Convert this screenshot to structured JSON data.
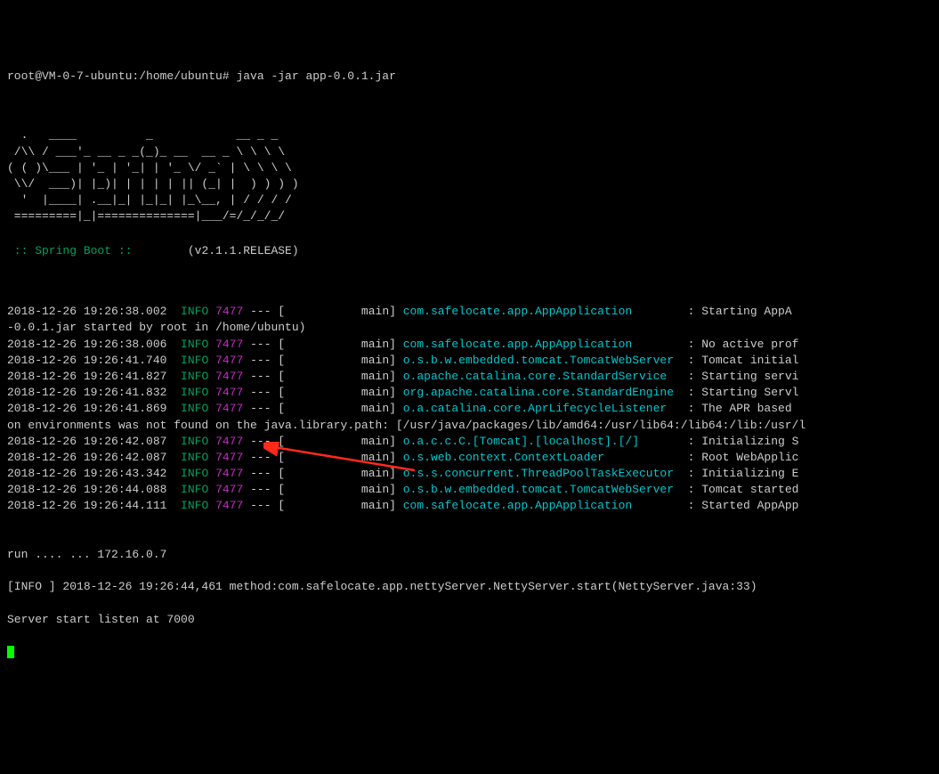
{
  "prompt": "root@VM-0-7-ubuntu:/home/ubuntu# java -jar app-0.0.1.jar",
  "ascii_art": "  .   ____          _            __ _ _\n /\\\\ / ___'_ __ _ _(_)_ __  __ _ \\ \\ \\ \\\n( ( )\\___ | '_ | '_| | '_ \\/ _` | \\ \\ \\ \\\n \\\\/  ___)| |_)| | | | | || (_| |  ) ) ) )\n  '  |____| .__|_| |_|_| |_\\__, | / / / /\n =========|_|==============|___/=/_/_/_/",
  "spring_boot_label": " :: Spring Boot :: ",
  "spring_boot_version": "       (v2.1.1.RELEASE)",
  "log_entries": [
    {
      "ts": "2018-12-26 19:26:38.002",
      "level": "INFO",
      "pid": "7477",
      "thread": "main",
      "logger": "com.safelocate.app.AppApplication      ",
      "msg": "Starting AppA"
    },
    {
      "continuation": "-0.0.1.jar started by root in /home/ubuntu)"
    },
    {
      "ts": "2018-12-26 19:26:38.006",
      "level": "INFO",
      "pid": "7477",
      "thread": "main",
      "logger": "com.safelocate.app.AppApplication      ",
      "msg": "No active prof"
    },
    {
      "ts": "2018-12-26 19:26:41.740",
      "level": "INFO",
      "pid": "7477",
      "thread": "main",
      "logger": "o.s.b.w.embedded.tomcat.TomcatWebServer",
      "msg": "Tomcat initial"
    },
    {
      "ts": "2018-12-26 19:26:41.827",
      "level": "INFO",
      "pid": "7477",
      "thread": "main",
      "logger": "o.apache.catalina.core.StandardService ",
      "msg": "Starting servi"
    },
    {
      "ts": "2018-12-26 19:26:41.832",
      "level": "INFO",
      "pid": "7477",
      "thread": "main",
      "logger": "org.apache.catalina.core.StandardEngine",
      "msg": "Starting Servl"
    },
    {
      "ts": "2018-12-26 19:26:41.869",
      "level": "INFO",
      "pid": "7477",
      "thread": "main",
      "logger": "o.a.catalina.core.AprLifecycleListener ",
      "msg": "The APR based "
    },
    {
      "continuation": "on environments was not found on the java.library.path: [/usr/java/packages/lib/amd64:/usr/lib64:/lib64:/lib:/usr/l"
    },
    {
      "ts": "2018-12-26 19:26:42.087",
      "level": "INFO",
      "pid": "7477",
      "thread": "main",
      "logger": "o.a.c.c.C.[Tomcat].[localhost].[/]     ",
      "msg": "Initializing S"
    },
    {
      "ts": "2018-12-26 19:26:42.087",
      "level": "INFO",
      "pid": "7477",
      "thread": "main",
      "logger": "o.s.web.context.ContextLoader          ",
      "msg": "Root WebApplic"
    },
    {
      "ts": "2018-12-26 19:26:43.342",
      "level": "INFO",
      "pid": "7477",
      "thread": "main",
      "logger": "o.s.s.concurrent.ThreadPoolTaskExecutor",
      "msg": "Initializing E"
    },
    {
      "ts": "2018-12-26 19:26:44.088",
      "level": "INFO",
      "pid": "7477",
      "thread": "main",
      "logger": "o.s.b.w.embedded.tomcat.TomcatWebServer",
      "msg": "Tomcat started"
    },
    {
      "ts": "2018-12-26 19:26:44.111",
      "level": "INFO",
      "pid": "7477",
      "thread": "main",
      "logger": "com.safelocate.app.AppApplication      ",
      "msg": "Started AppApp"
    }
  ],
  "tail_lines": [
    "run .... ... 172.16.0.7",
    "[INFO ] 2018-12-26 19:26:44,461 method:com.safelocate.app.nettyServer.NettyServer.start(NettyServer.java:33)",
    "Server start listen at 7000"
  ],
  "arrow_color": "#ff2a1a"
}
